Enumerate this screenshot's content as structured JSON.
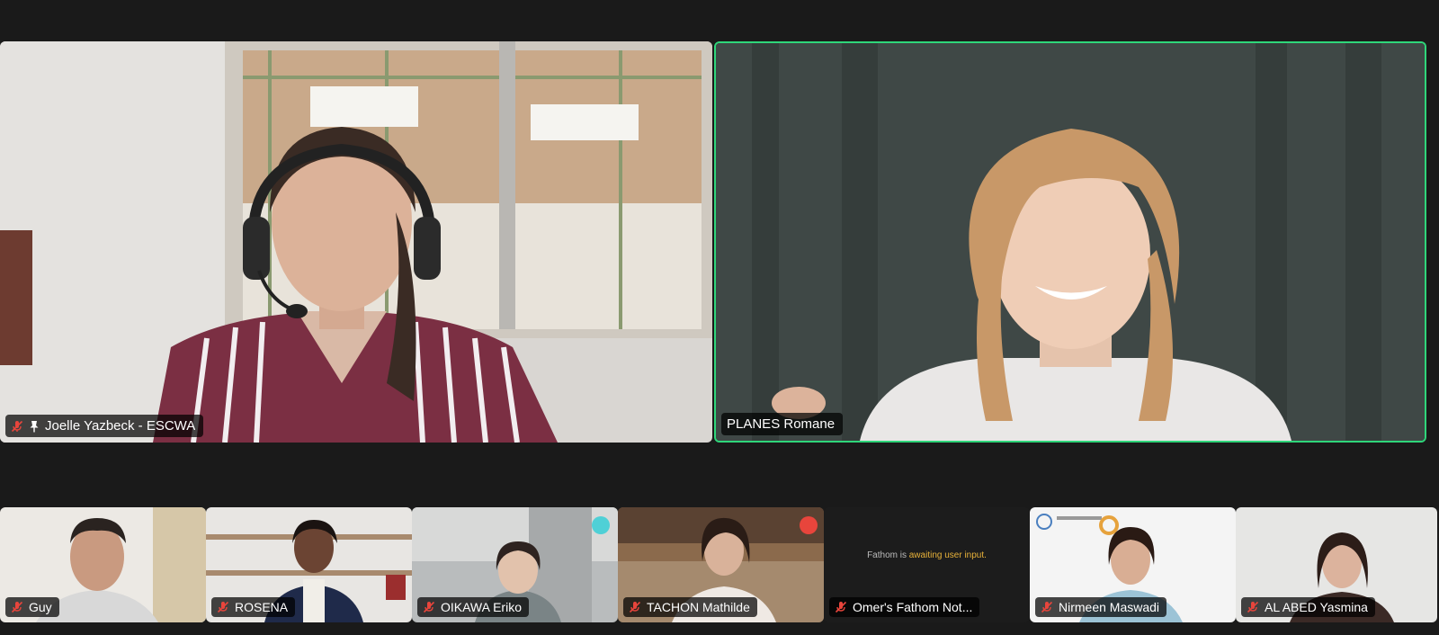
{
  "participants": {
    "main": [
      {
        "name": "Joelle Yazbeck - ESCWA",
        "muted": true,
        "pinned": true
      },
      {
        "name": "PLANES Romane",
        "muted": false,
        "active_speaker": true
      }
    ],
    "thumbnails": [
      {
        "name": "Guy",
        "muted": true
      },
      {
        "name": "ROSENA",
        "muted": true
      },
      {
        "name": "OIKAWA Eriko",
        "muted": true
      },
      {
        "name": "TACHON Mathilde",
        "muted": true
      },
      {
        "name": "Omer's Fathom Not...",
        "muted": true
      },
      {
        "name": "Nirmeen Maswadi",
        "muted": true
      },
      {
        "name": "AL ABED Yasmina",
        "muted": true
      }
    ]
  },
  "fathom": {
    "msg_prefix": "Fathom is ",
    "msg_highlight": "awaiting user input."
  },
  "colors": {
    "active_speaker_border": "#2fd67a",
    "muted_icon": "#e8453c",
    "background": "#1a1a1a"
  },
  "icons": {
    "muted": "mic-muted-icon",
    "pinned": "pin-icon"
  }
}
